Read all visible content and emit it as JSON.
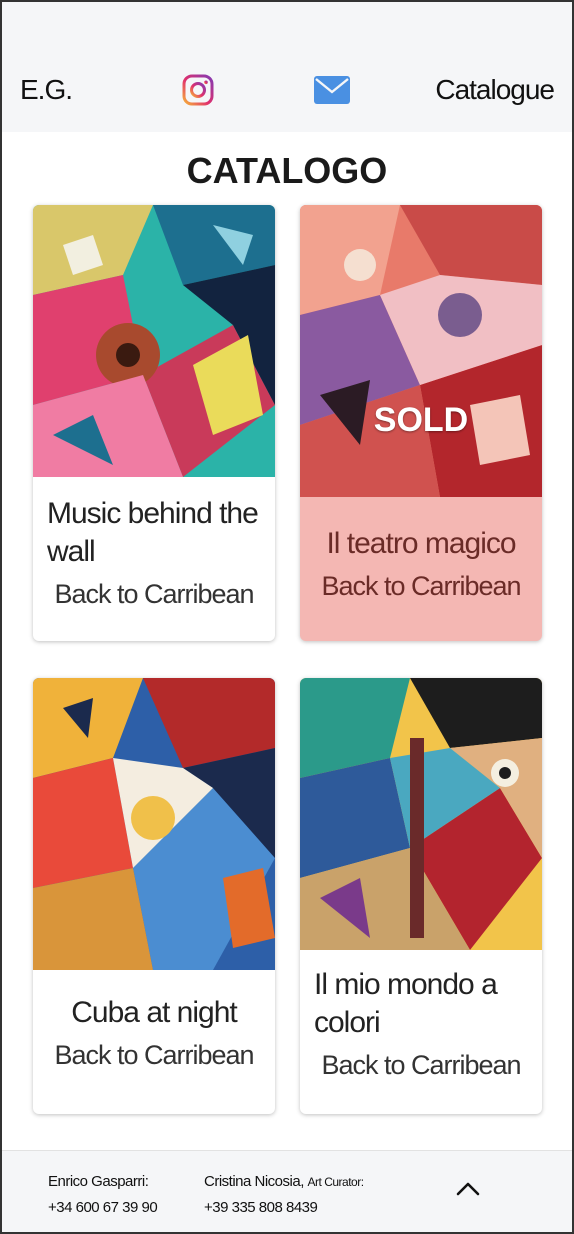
{
  "header": {
    "brand": "E.G.",
    "nav_catalogue": "Catalogue"
  },
  "page": {
    "title": "CATALOGO"
  },
  "cards": [
    {
      "title": "Music behind the wall",
      "subtitle": "Back to Carribean",
      "sold": false
    },
    {
      "title": "Il teatro magico",
      "subtitle": "Back to Carribean",
      "sold": true,
      "badge": "SOLD"
    },
    {
      "title": "Cuba at night",
      "subtitle": "Back to Carribean",
      "sold": false
    },
    {
      "title": "Il mio mondo a colori",
      "subtitle": "Back to Carribean",
      "sold": false
    }
  ],
  "footer": {
    "contact1_name": "Enrico Gasparri:",
    "contact1_phone": "+34 600 67 39 90",
    "contact2_name": "Cristina Nicosia,",
    "contact2_role": "Art Curator:",
    "contact2_phone": "+39 335 808 8439"
  },
  "colors": {
    "header_bg": "#f5f6f8",
    "sold_card_bg": "#f4b7b3",
    "sold_text": "#6a2b27",
    "mail_blue": "#4a90e2"
  },
  "icons": [
    "instagram-icon",
    "mail-icon",
    "chevron-up-icon"
  ]
}
